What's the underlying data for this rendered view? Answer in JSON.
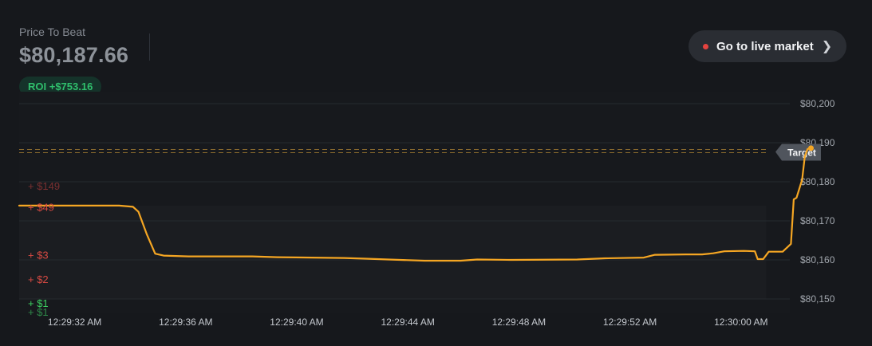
{
  "header": {
    "price_label": "Price To Beat",
    "price_value": "$80,187.66",
    "roi": "ROI +$753.16"
  },
  "live_button": {
    "label": "Go to live market"
  },
  "target_label": "Target",
  "markers": [
    {
      "text": "+ $149",
      "y": 80179,
      "color": "#7a3030"
    },
    {
      "text": "+ $49",
      "y": 80173.6,
      "color": "#d74a43"
    },
    {
      "text": "+ $3",
      "y": 80161.3,
      "color": "#d74a43"
    },
    {
      "text": "+ $2",
      "y": 80155.1,
      "color": "#d74a43"
    },
    {
      "text": "+ $1",
      "y": 80149,
      "color": "#3cd060"
    },
    {
      "text": "+ $1",
      "y": 80146.7,
      "color": "#2f8a4a"
    }
  ],
  "colors": {
    "line": "#f5a623",
    "target": "#8a6a2e",
    "background": "#16181c"
  },
  "chart_data": {
    "type": "line",
    "title": "",
    "xlabel": "",
    "ylabel": "",
    "x_unit": "seconds after 12:29:30 AM",
    "ylim": [
      80149,
      80200
    ],
    "xlim": [
      0,
      30.6
    ],
    "y_ticks": [
      {
        "value": 80200,
        "label": "$80,200"
      },
      {
        "value": 80190,
        "label": "$80,190"
      },
      {
        "value": 80180,
        "label": "$80,180"
      },
      {
        "value": 80170,
        "label": "$80,170"
      },
      {
        "value": 80160,
        "label": "$80,160"
      },
      {
        "value": 80150,
        "label": "$80,150"
      }
    ],
    "x_ticks": [
      {
        "value": 2,
        "label": "12:29:32 AM"
      },
      {
        "value": 6,
        "label": "12:29:36 AM"
      },
      {
        "value": 10,
        "label": "12:29:40 AM"
      },
      {
        "value": 14,
        "label": "12:29:44 AM"
      },
      {
        "value": 18,
        "label": "12:29:48 AM"
      },
      {
        "value": 22,
        "label": "12:29:52 AM"
      },
      {
        "value": 26,
        "label": "12:30:00 AM"
      }
    ],
    "target": 80187.66,
    "series": [
      {
        "values": [
          [
            0,
            80173.9
          ],
          [
            2.2,
            80173.9
          ],
          [
            3.6,
            80173.9
          ],
          [
            4.1,
            80173.6
          ],
          [
            4.3,
            80172.3
          ],
          [
            4.6,
            80166.5
          ],
          [
            4.9,
            80161.6
          ],
          [
            5.2,
            80161.1
          ],
          [
            6.1,
            80160.9
          ],
          [
            8.4,
            80160.9
          ],
          [
            9.3,
            80160.7
          ],
          [
            11.7,
            80160.5
          ],
          [
            12.5,
            80160.3
          ],
          [
            13.3,
            80160.1
          ],
          [
            14.6,
            80159.8
          ],
          [
            15.9,
            80159.8
          ],
          [
            16.5,
            80160.1
          ],
          [
            17.7,
            80160.0
          ],
          [
            20.1,
            80160.1
          ],
          [
            21.1,
            80160.4
          ],
          [
            22.5,
            80160.6
          ],
          [
            22.9,
            80161.3
          ],
          [
            24.0,
            80161.4
          ],
          [
            24.6,
            80161.4
          ],
          [
            25.0,
            80161.7
          ],
          [
            25.4,
            80162.2
          ],
          [
            26.1,
            80162.3
          ],
          [
            26.5,
            80162.2
          ],
          [
            26.6,
            80160.2
          ],
          [
            26.8,
            80160.2
          ],
          [
            27.0,
            80162.1
          ],
          [
            27.5,
            80162.1
          ],
          [
            27.8,
            80164.1
          ],
          [
            27.9,
            80175.5
          ],
          [
            28.0,
            80175.9
          ],
          [
            28.2,
            80180.5
          ],
          [
            28.3,
            80186.5
          ],
          [
            28.4,
            80188.4
          ],
          [
            28.5,
            80188.6
          ],
          [
            28.52,
            80188.6
          ]
        ]
      }
    ]
  }
}
